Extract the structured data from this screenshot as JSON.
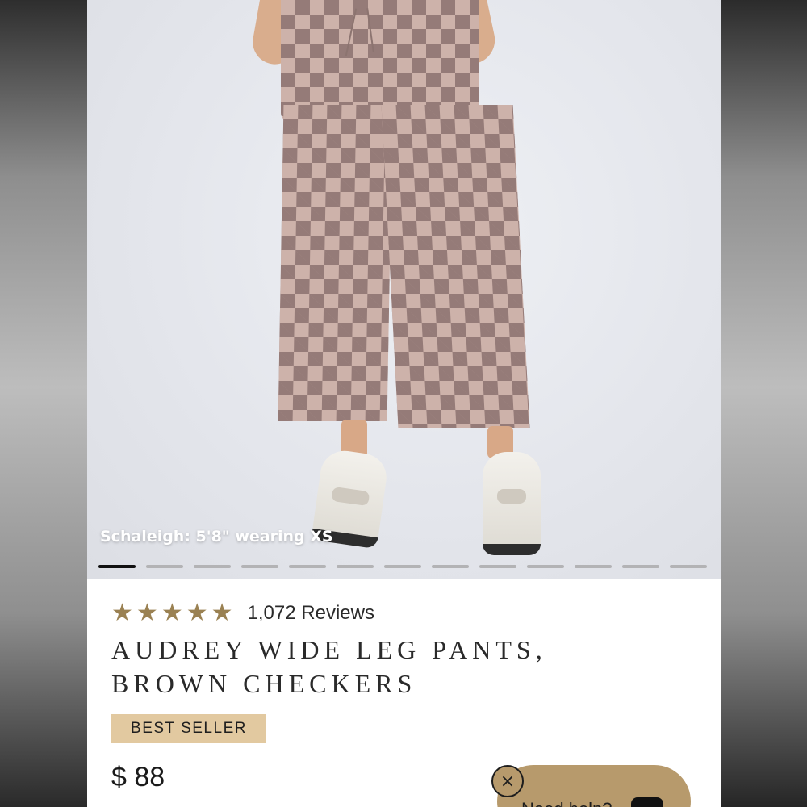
{
  "gallery": {
    "caption": "Schaleigh: 5'8\" wearing XS",
    "total_slides": 13,
    "active_slide": 1
  },
  "product": {
    "rating_stars": 5,
    "reviews": "1,072 Reviews",
    "title": "AUDREY WIDE LEG PANTS, BROWN CHECKERS",
    "badge": "BEST SELLER",
    "price": "$ 88"
  },
  "chat_widget": {
    "close_icon": "×",
    "label": "Need help?",
    "icon": "chat-icon"
  },
  "colors": {
    "star": "#9a8152",
    "badge_bg": "#e2c9a0",
    "chat_bg": "#b79a6c",
    "active_dot": "#111111"
  }
}
